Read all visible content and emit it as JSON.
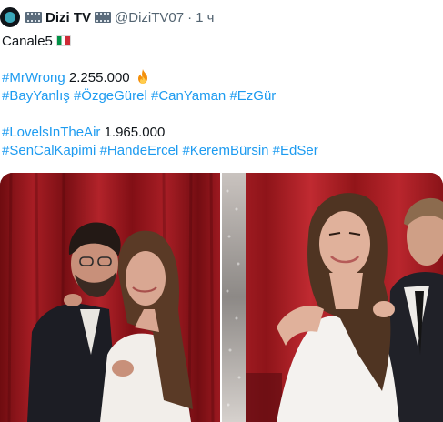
{
  "header": {
    "display_name": "Dizi TV",
    "handle": "@DiziTV07",
    "separator": "·",
    "time": "1 ч",
    "icons": [
      "avatar",
      "film-icon",
      "film-icon"
    ]
  },
  "body": {
    "line1": "Canale5",
    "line1_flag": "italy-flag-icon",
    "show1_tag": "#MrWrong",
    "show1_views": "2.255.000",
    "show1_icon": "fire-icon",
    "show1_hashtags": [
      "#BayYanlış",
      "#ÖzgeGürel",
      "#CanYaman",
      "#EzGür"
    ],
    "show2_tag": "#LovelsInTheAir",
    "show2_views": "1.965.000",
    "show2_hashtags": [
      "#SenCalKapimi",
      "#HandeErcel",
      "#KeremBürsin",
      "#EdSer"
    ]
  },
  "media": {
    "photos": [
      "photo-left",
      "photo-right"
    ]
  },
  "colors": {
    "text": "#0f1419",
    "secondary": "#536471",
    "link": "#1d9bf0",
    "curtain_red": "#9b1b22"
  }
}
